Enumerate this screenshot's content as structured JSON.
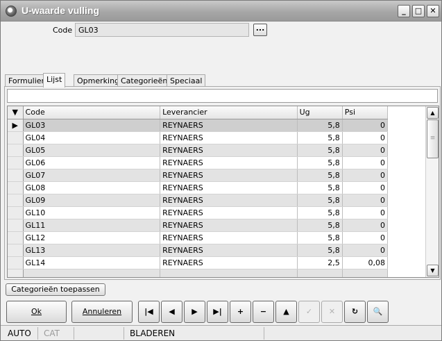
{
  "window": {
    "title": "U-waarde vulling",
    "minimize": "_",
    "maximize": "□",
    "close": "✕"
  },
  "header": {
    "code_label": "Code :",
    "code_value": "GL03",
    "browse_label": "..."
  },
  "tabs": [
    {
      "label": "Formulier"
    },
    {
      "label": "Lijst"
    },
    {
      "label": "Opmerking"
    },
    {
      "label": "Categorieën"
    },
    {
      "label": "Speciaal"
    }
  ],
  "grid": {
    "columns": [
      "Code",
      "Leverancier",
      "Ug",
      "Psi"
    ],
    "rows": [
      {
        "code": "GL03",
        "leverancier": "REYNAERS",
        "ug": "5,8",
        "psi": "0"
      },
      {
        "code": "GL04",
        "leverancier": "REYNAERS",
        "ug": "5,8",
        "psi": "0"
      },
      {
        "code": "GL05",
        "leverancier": "REYNAERS",
        "ug": "5,8",
        "psi": "0"
      },
      {
        "code": "GL06",
        "leverancier": "REYNAERS",
        "ug": "5,8",
        "psi": "0"
      },
      {
        "code": "GL07",
        "leverancier": "REYNAERS",
        "ug": "5,8",
        "psi": "0"
      },
      {
        "code": "GL08",
        "leverancier": "REYNAERS",
        "ug": "5,8",
        "psi": "0"
      },
      {
        "code": "GL09",
        "leverancier": "REYNAERS",
        "ug": "5,8",
        "psi": "0"
      },
      {
        "code": "GL10",
        "leverancier": "REYNAERS",
        "ug": "5,8",
        "psi": "0"
      },
      {
        "code": "GL11",
        "leverancier": "REYNAERS",
        "ug": "5,8",
        "psi": "0"
      },
      {
        "code": "GL12",
        "leverancier": "REYNAERS",
        "ug": "5,8",
        "psi": "0"
      },
      {
        "code": "GL13",
        "leverancier": "REYNAERS",
        "ug": "5,8",
        "psi": "0"
      },
      {
        "code": "GL14",
        "leverancier": "REYNAERS",
        "ug": "2,5",
        "psi": "0,08"
      }
    ]
  },
  "actions": {
    "apply_categories": "Categorieën toepassen",
    "ok": "Ok",
    "cancel": "Annuleren"
  },
  "navigator": {
    "first": "|◀",
    "prior": "◀",
    "next": "▶",
    "last": "▶|",
    "insert": "+",
    "delete": "−",
    "edit": "▲",
    "post": "✓",
    "cancel_edit": "✕",
    "refresh": "↻",
    "search": "🔍"
  },
  "status": {
    "auto": "AUTO",
    "cat": "CAT",
    "mode": "BLADEREN"
  }
}
